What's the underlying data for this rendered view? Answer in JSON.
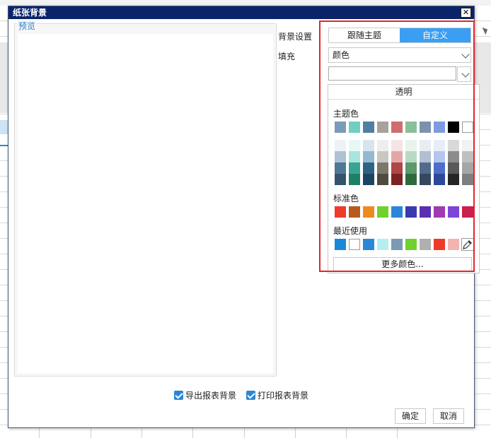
{
  "dialog": {
    "title": "纸张背景",
    "close_glyph": "✕",
    "preview_legend": "预览"
  },
  "settings": {
    "bg_label": "背景设置",
    "fill_label": "填充",
    "tab_follow_theme": "跟随主题",
    "tab_custom": "自定义",
    "fill_value": "颜色"
  },
  "palette": {
    "transparent_label": "透明",
    "theme_label": "主题色",
    "standard_label": "标准色",
    "recent_label": "最近使用",
    "more_colors_label": "更多颜色...",
    "theme_row": [
      "#7b9cb8",
      "#6fcfc0",
      "#4f7fa0",
      "#a8a39a",
      "#cf6e6e",
      "#8abf98",
      "#7a93ad",
      "#7e9be0",
      "#000000",
      "#ffffff"
    ],
    "theme_shades": [
      [
        "#eef2f6",
        "#e6f8f6",
        "#d8e5ee",
        "#efeeeb",
        "#f6e3e3",
        "#e8f3eb",
        "#e8edf2",
        "#e8edf9",
        "#d9d9d9",
        "#f2f2f2"
      ],
      [
        "#adc2d4",
        "#a9e5dc",
        "#95b8cf",
        "#cbc7c0",
        "#e4a7a7",
        "#b9dac2",
        "#b0c0d0",
        "#b4c6f0",
        "#8c8c8c",
        "#bfbfbf"
      ],
      [
        "#4f7896",
        "#37a592",
        "#2f6386",
        "#7d776b",
        "#b04646",
        "#5a9a6b",
        "#506c8a",
        "#4e6ec8",
        "#595959",
        "#a6a6a6"
      ],
      [
        "#33546c",
        "#208067",
        "#1c4463",
        "#4f4a3f",
        "#7d2222",
        "#2f6a3f",
        "#35485e",
        "#2c4a99",
        "#262626",
        "#7f7f7f"
      ]
    ],
    "standard_row": [
      "#ee3b2b",
      "#b85a1e",
      "#ee8a1c",
      "#6fd12e",
      "#2b86d8",
      "#3a3ab0",
      "#5a2fb0",
      "#a03ab0",
      "#7d44d8",
      "#c8204a"
    ],
    "recent_row": [
      "#1a88d9",
      "#ffffff",
      "#2b86d8",
      "#b3efee",
      "#7a9ab6",
      "#6fd12e",
      "#b0b0b0",
      "#ee3b2b",
      "#f3b4ad"
    ],
    "picker_icon": "eyedropper-icon"
  },
  "options": {
    "export_bg": "导出报表背景",
    "print_bg": "打印报表背景"
  },
  "buttons": {
    "ok": "确定",
    "cancel": "取消"
  },
  "colors": {
    "accent": "#3a9ef2",
    "titlebar": "#0a246a",
    "highlight_frame": "#e0262b"
  }
}
